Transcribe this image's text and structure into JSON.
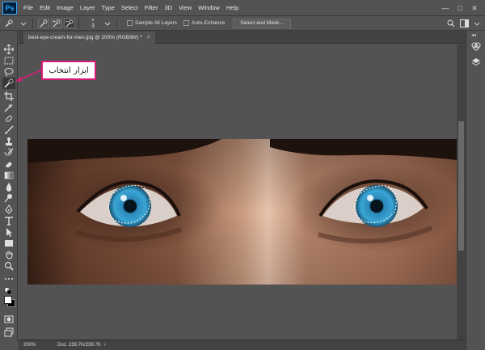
{
  "app": {
    "logo": "Ps",
    "menu": [
      "File",
      "Edit",
      "Image",
      "Layer",
      "Type",
      "Select",
      "Filter",
      "3D",
      "View",
      "Window",
      "Help"
    ],
    "window_controls": {
      "minimize": "—",
      "maximize": "□",
      "close": "✕"
    }
  },
  "options_bar": {
    "brush_size": "3",
    "sample_all_layers": "Sample All Layers",
    "auto_enhance": "Auto-Enhance",
    "select_and_mask": "Select and Mask..."
  },
  "document": {
    "tab_title": "best-eye-cream-for-men.jpg @ 200% (RGB/8#) *",
    "tab_close": "×"
  },
  "status": {
    "zoom": "200%",
    "doc_info": "Doc: 239.7K/239.7K",
    "arrow": "›"
  },
  "annotation": {
    "label": "ابزار انتخاب",
    "color": "#d81c7a"
  },
  "colors": {
    "ui_bg": "#535353",
    "panel_dark": "#424242",
    "accent": "#31a8ff"
  },
  "icons": {
    "tools": [
      "move-icon",
      "marquee-icon",
      "lasso-icon",
      "quick-selection-icon",
      "crop-icon",
      "eyedropper-icon",
      "healing-brush-icon",
      "brush-icon",
      "clone-stamp-icon",
      "history-brush-icon",
      "eraser-icon",
      "gradient-icon",
      "blur-icon",
      "dodge-icon",
      "pen-icon",
      "type-icon",
      "path-selection-icon",
      "rectangle-icon",
      "hand-icon",
      "zoom-icon",
      "more-tools-icon"
    ]
  }
}
